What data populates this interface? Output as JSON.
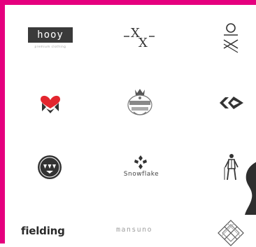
{
  "colors": {
    "frame_accent": "#e5007e",
    "logo_dark": "#333333",
    "logo_red": "#e3262f",
    "logo_gray": "#a0a0a0"
  },
  "logos": {
    "hooy": {
      "name": "hooy",
      "tagline": "premium clothing"
    },
    "xx": {
      "text": "-X-X-"
    },
    "snowflake": {
      "label": "Snowflake"
    },
    "fielding": {
      "text": "fielding"
    },
    "mansuno": {
      "text": "mansuno"
    }
  },
  "icons": [
    "knot-icon",
    "heart-arrows-icon",
    "crest-icon",
    "chevrons-diamond-icon",
    "triangles-badge-icon",
    "snowflake-icon",
    "walking-figure-icon",
    "diamond-lattice-icon",
    "pink-swirl-shape"
  ]
}
